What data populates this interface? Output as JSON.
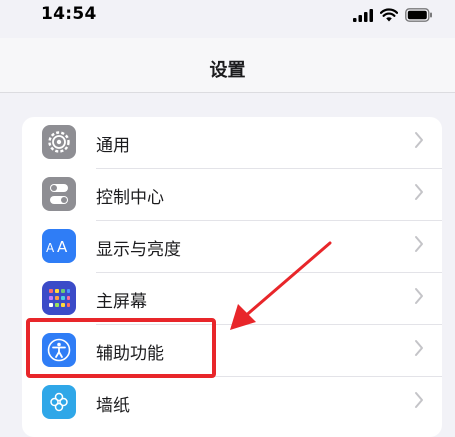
{
  "status": {
    "time": "14:54"
  },
  "nav": {
    "title": "设置"
  },
  "settings": {
    "items": [
      {
        "label": "通用",
        "icon": "gear-icon",
        "color": "#8e8e93"
      },
      {
        "label": "控制中心",
        "icon": "toggles-icon",
        "color": "#8e8e93"
      },
      {
        "label": "显示与亮度",
        "icon": "text-size-icon",
        "color": "#2f7df6"
      },
      {
        "label": "主屏幕",
        "icon": "app-grid-icon",
        "color": "#3b4bc8"
      },
      {
        "label": "辅助功能",
        "icon": "accessibility-icon",
        "color": "#2f7df6"
      },
      {
        "label": "墙纸",
        "icon": "wallpaper-icon",
        "color": "#2fa7e8"
      }
    ]
  },
  "annotation": {
    "highlight_color": "#e8262a"
  }
}
